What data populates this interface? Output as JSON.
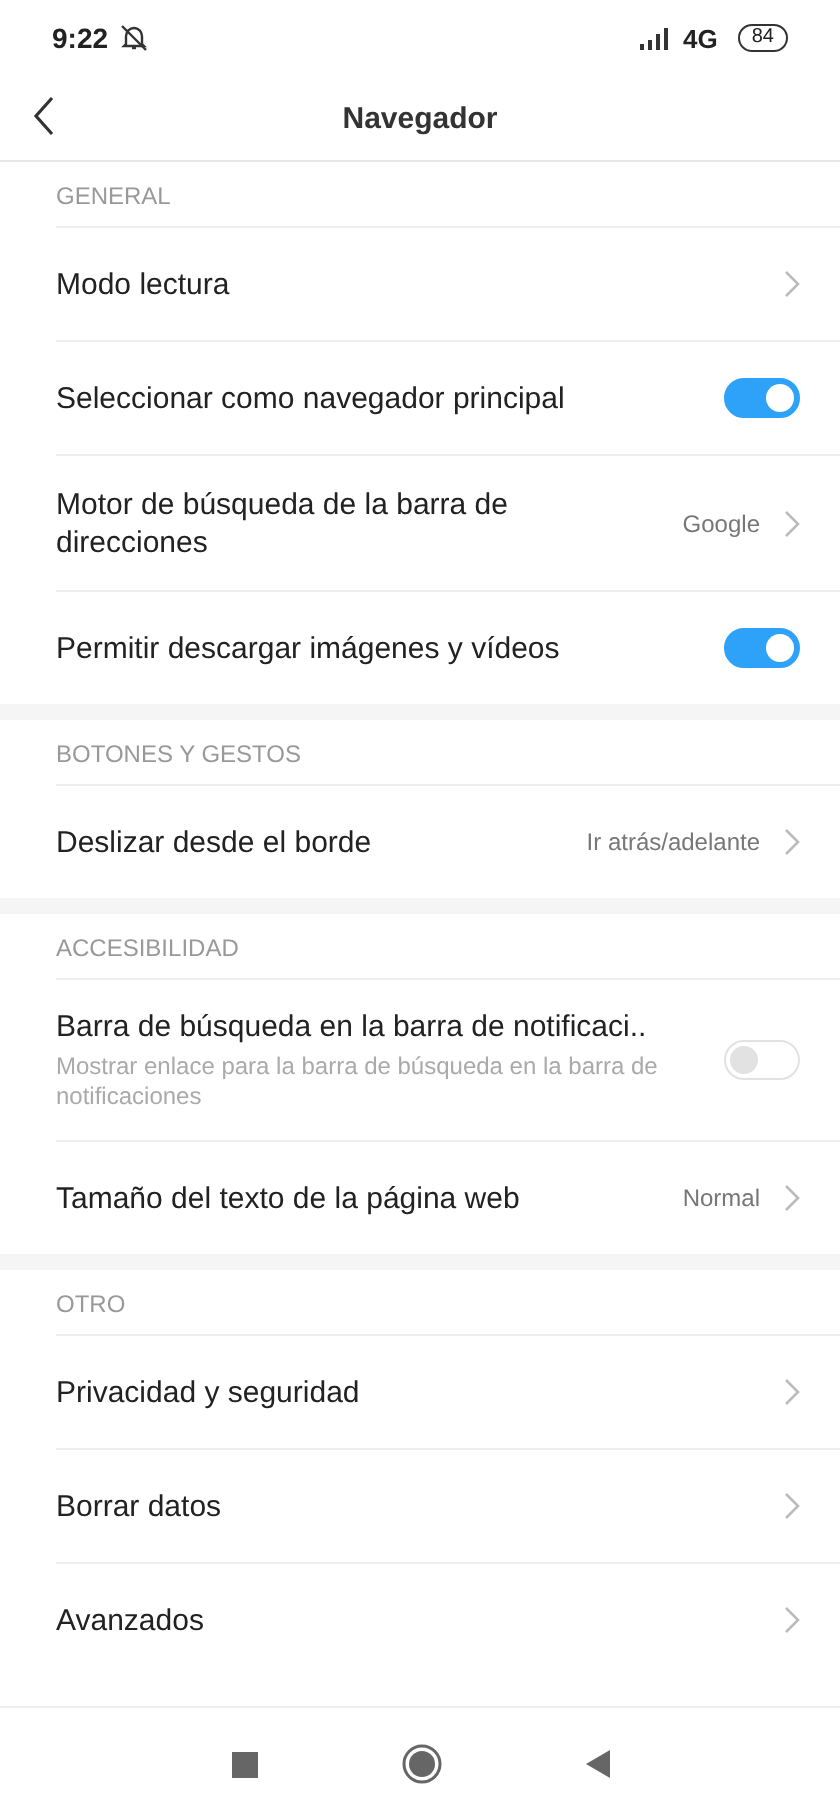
{
  "status_bar": {
    "time": "9:22",
    "network": "4G",
    "battery": "84"
  },
  "header": {
    "title": "Navegador"
  },
  "sections": [
    {
      "title": "GENERAL",
      "items": [
        {
          "kind": "link",
          "label": "Modo lectura"
        },
        {
          "kind": "toggle",
          "label": "Seleccionar como navegador principal",
          "on": true
        },
        {
          "kind": "link",
          "label": "Motor de búsqueda de la barra de direcciones",
          "value": "Google"
        },
        {
          "kind": "toggle",
          "label": "Permitir descargar imágenes y vídeos",
          "on": true
        }
      ]
    },
    {
      "title": "BOTONES Y GESTOS",
      "items": [
        {
          "kind": "link",
          "label": "Deslizar desde el borde",
          "value": "Ir atrás/adelante"
        }
      ]
    },
    {
      "title": "ACCESIBILIDAD",
      "items": [
        {
          "kind": "toggle",
          "label": "Barra de búsqueda en la barra de notificaci..",
          "description": "Mostrar enlace para la barra de búsqueda en la barra de notificaciones",
          "on": false
        },
        {
          "kind": "link",
          "label": "Tamaño del texto de la página web",
          "value": "Normal"
        }
      ]
    },
    {
      "title": "OTRO",
      "items": [
        {
          "kind": "link",
          "label": "Privacidad y seguridad"
        },
        {
          "kind": "link",
          "label": "Borrar datos"
        },
        {
          "kind": "link",
          "label": "Avanzados"
        }
      ]
    }
  ]
}
